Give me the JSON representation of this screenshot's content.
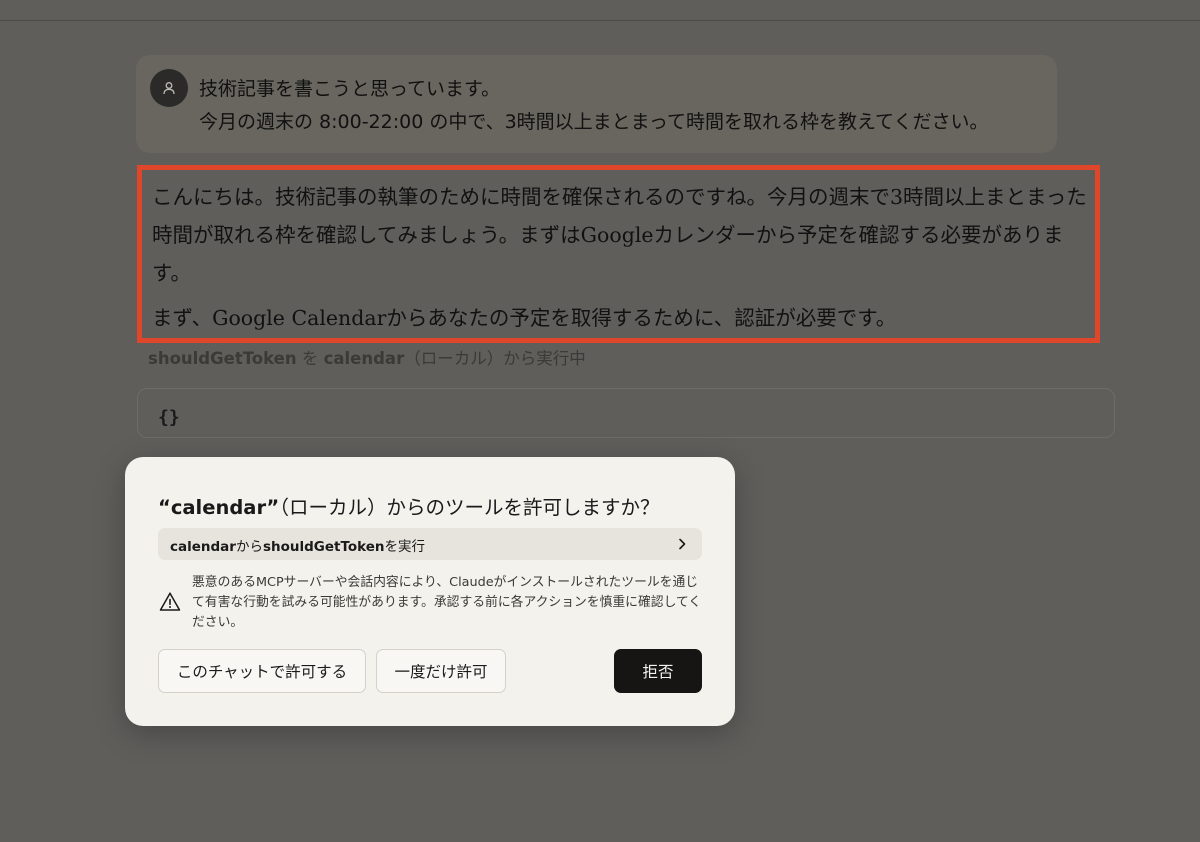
{
  "chat": {
    "user_message": {
      "line1": "技術記事を書こうと思っています。",
      "line2": "今月の週末の 8:00-22:00 の中で、3時間以上まとまって時間を取れる枠を教えてください。"
    },
    "assistant_message": {
      "paragraph1": "こんにちは。技術記事の執筆のために時間を確保されるのですね。今月の週末で3時間以上まとまった時間が取れる枠を確認してみましょう。まずはGoogleカレンダーから予定を確認する必要があります。",
      "paragraph2": "まず、Google Calendarからあなたの予定を取得するために、認証が必要です。"
    },
    "tool_status": {
      "tool_name": "shouldGetToken",
      "connector1": " を ",
      "server_name": "calendar",
      "suffix": "（ローカル）から実行中"
    },
    "tool_input": "{}"
  },
  "dialog": {
    "title_quoted": "“calendar”",
    "title_rest": "（ローカル）からのツールを許可しますか？",
    "tool_row": {
      "server": "calendar",
      "connector": "から",
      "tool": "shouldGetToken",
      "suffix": "を実行"
    },
    "warning": "悪意のあるMCPサーバーや会話内容により、Claudeがインストールされたツールを通じて有害な行動を試みる可能性があります。承認する前に各アクションを慎重に確認してください。",
    "buttons": {
      "allow_chat": "このチャットで許可する",
      "allow_once": "一度だけ許可",
      "deny": "拒否"
    }
  },
  "colors": {
    "overlay_bg": "#5f5e5b",
    "highlight_border": "#e0462a",
    "dialog_bg": "#f4f2ed",
    "deny_button": "#161513"
  },
  "icons": {
    "avatar": "user-icon",
    "tool_row": "chevron-right-icon",
    "warning": "warning-triangle-icon"
  }
}
